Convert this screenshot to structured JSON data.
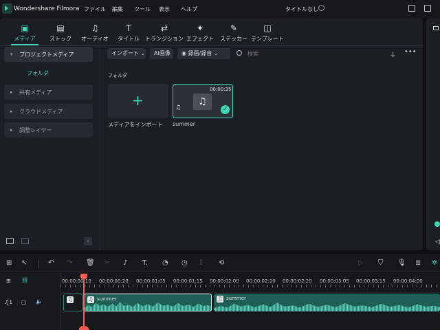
{
  "app": {
    "name": "Wondershare Filmora",
    "doc_title": "タイトルなし"
  },
  "menu": [
    "ファイル",
    "編集",
    "ツール",
    "表示",
    "ヘルプ"
  ],
  "tabs": [
    {
      "label": "メディア",
      "icon": "media-icon"
    },
    {
      "label": "ストック",
      "icon": "stock-icon"
    },
    {
      "label": "オーディオ",
      "icon": "music-note-icon"
    },
    {
      "label": "タイトル",
      "icon": "title-t-icon"
    },
    {
      "label": "トランジション",
      "icon": "transition-icon"
    },
    {
      "label": "エフェクト",
      "icon": "effect-icon"
    },
    {
      "label": "ステッカー",
      "icon": "sticker-icon"
    },
    {
      "label": "テンプレート",
      "icon": "template-icon"
    }
  ],
  "sidebar": {
    "project": "プロジェクトメディア",
    "folder": "フォルダ",
    "items": [
      "共有メディア",
      "クラウドメディア",
      "調整レイヤー"
    ]
  },
  "toolbar": {
    "import": "インポート",
    "ai_image": "AI画像",
    "record": "録画/録音",
    "search_placeholder": "検索"
  },
  "content": {
    "heading": "フォルダ",
    "import_tile_label": "メディアをインポート",
    "media": [
      {
        "name": "summer",
        "duration": "00:00:35"
      }
    ]
  },
  "timeline": {
    "ruler": [
      "00:00:00:10",
      "00:00:00:20",
      "00:00:01:05",
      "00:00:01:15",
      "00:00:02:00",
      "00:00:02:10",
      "00:00:02:20",
      "00:00:03:05",
      "00:00:03:15",
      "00:00:04:00"
    ],
    "clips": [
      {
        "label": "summer"
      },
      {
        "label": "summer"
      }
    ]
  },
  "colors": {
    "accent": "#3fd6b8",
    "playhead": "#ff5a4e"
  }
}
